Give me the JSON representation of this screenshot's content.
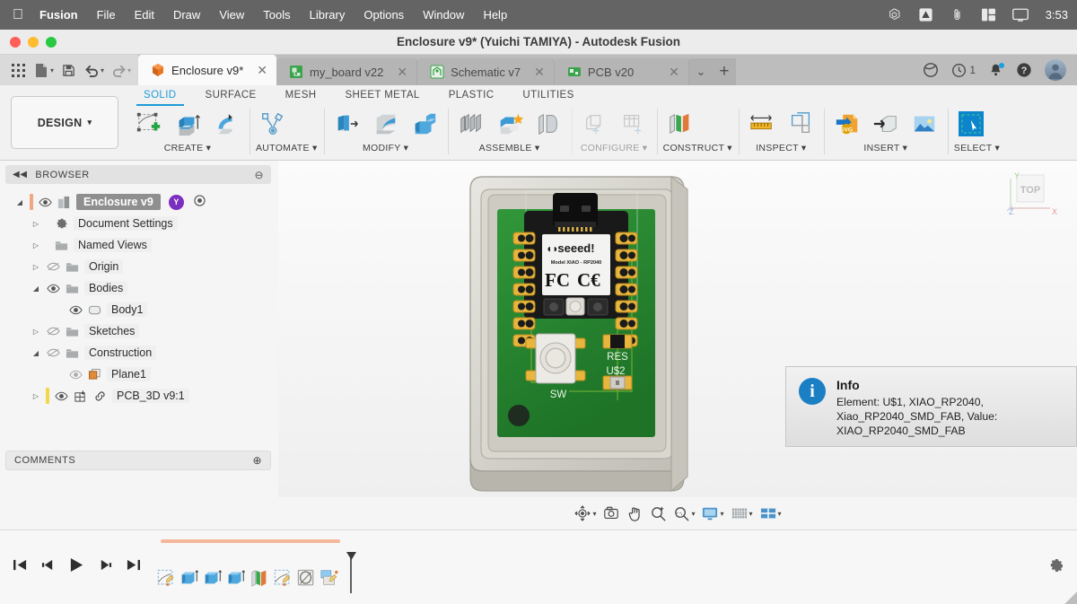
{
  "macmenu": {
    "apple": "apple-logo",
    "items": [
      {
        "label": "Fusion",
        "bold": true
      },
      {
        "label": "File",
        "bold": false
      },
      {
        "label": "Edit",
        "bold": false
      },
      {
        "label": "Draw",
        "bold": false
      },
      {
        "label": "View",
        "bold": false
      },
      {
        "label": "Tools",
        "bold": false
      },
      {
        "label": "Library",
        "bold": false
      },
      {
        "label": "Options",
        "bold": false
      },
      {
        "label": "Window",
        "bold": false
      },
      {
        "label": "Help",
        "bold": false
      }
    ],
    "status_icons": [
      "openai-icon",
      "autodesk-icon",
      "paperclip-icon",
      "layout-icon",
      "display-icon"
    ],
    "clock": "3:53"
  },
  "window": {
    "title": "Enclosure v9* (Yuichi TAMIYA) - Autodesk Fusion",
    "traffic_lights": [
      "close-button",
      "minimize-button",
      "zoom-button"
    ]
  },
  "quick_access": {
    "buttons": [
      "grid-apps-icon",
      "new-document-icon",
      "save-icon",
      "undo-icon",
      "redo-icon"
    ]
  },
  "tabs": [
    {
      "label": "Enclosure v9*",
      "icon": "fusion-design-icon",
      "active": true,
      "close": "✕"
    },
    {
      "label": "my_board v22",
      "icon": "pcb-board-icon",
      "active": false,
      "close": "✕"
    },
    {
      "label": "Schematic v7",
      "icon": "schematic-icon",
      "active": false,
      "close": "✕"
    },
    {
      "label": "PCB v20",
      "icon": "pcb-icon",
      "active": false,
      "close": "✕"
    }
  ],
  "tab_controls": {
    "dropdown": "⌄",
    "add": "+"
  },
  "tab_right": {
    "icons": [
      "job-status-icon",
      "extension-icon",
      "notification-bell-icon",
      "help-icon",
      "account-avatar"
    ],
    "extension_count": "1"
  },
  "ribbon": {
    "design_button": "DESIGN",
    "design_caret": "▾",
    "env_tabs": [
      {
        "label": "SOLID",
        "active": true
      },
      {
        "label": "SURFACE",
        "active": false
      },
      {
        "label": "MESH",
        "active": false
      },
      {
        "label": "SHEET METAL",
        "active": false
      },
      {
        "label": "PLASTIC",
        "active": false
      },
      {
        "label": "UTILITIES",
        "active": false
      }
    ],
    "panels": [
      {
        "label": "CREATE",
        "caret": "▾",
        "icons": [
          "create-sketch-icon",
          "extrude-icon",
          "revolve-icon"
        ]
      },
      {
        "label": "AUTOMATE",
        "caret": "▾",
        "icons": [
          "automate-icon"
        ]
      },
      {
        "label": "MODIFY",
        "caret": "▾",
        "icons": [
          "press-pull-icon",
          "fillet-icon",
          "shell-icon"
        ]
      },
      {
        "label": "ASSEMBLE",
        "caret": "▾",
        "icons": [
          "new-component-icon",
          "joint-icon",
          "rigid-group-icon"
        ]
      },
      {
        "label": "CONFIGURE",
        "caret": "▾",
        "icons": [
          "configure-icon",
          "config-table-icon"
        ]
      },
      {
        "label": "CONSTRUCT",
        "caret": "▾",
        "icons": [
          "construct-plane-icon"
        ]
      },
      {
        "label": "INSPECT",
        "caret": "▾",
        "icons": [
          "measure-icon",
          "section-analysis-icon"
        ]
      },
      {
        "label": "INSERT",
        "caret": "▾",
        "icons": [
          "insert-svg-icon",
          "insert-derive-icon",
          "insert-image-icon"
        ]
      },
      {
        "label": "SELECT",
        "caret": "▾",
        "icons": [
          "select-window-icon"
        ]
      }
    ]
  },
  "browser": {
    "header": "BROWSER",
    "collapse_icon": "collapse-left-icon",
    "minus_icon": "⊖",
    "tree": [
      {
        "indent": 0,
        "arrow": "◢",
        "eye": "visible",
        "icon": "component-icon",
        "label": "Enclosure v9",
        "root": true,
        "badge": "Y",
        "radio": "radio-icon",
        "marker": "#f0a882"
      },
      {
        "indent": 1,
        "arrow": "▷",
        "eye": "none",
        "icon": "gear-icon",
        "label": "Document Settings",
        "root": false
      },
      {
        "indent": 1,
        "arrow": "▷",
        "eye": "none",
        "icon": "folder-icon",
        "label": "Named Views",
        "root": false
      },
      {
        "indent": 1,
        "arrow": "▷",
        "eye": "hidden",
        "icon": "folder-icon",
        "label": "Origin",
        "root": false
      },
      {
        "indent": 1,
        "arrow": "◢",
        "eye": "visible",
        "icon": "folder-icon",
        "label": "Bodies",
        "root": false
      },
      {
        "indent": 2,
        "arrow": "",
        "eye": "visible",
        "icon": "body-icon",
        "label": "Body1",
        "root": false
      },
      {
        "indent": 1,
        "arrow": "▷",
        "eye": "hidden",
        "icon": "folder-icon",
        "label": "Sketches",
        "root": false
      },
      {
        "indent": 1,
        "arrow": "◢",
        "eye": "hidden",
        "icon": "folder-icon",
        "label": "Construction",
        "root": false
      },
      {
        "indent": 2,
        "arrow": "",
        "eye": "visible-dim",
        "icon": "plane-icon",
        "label": "Plane1",
        "root": false
      },
      {
        "indent": 1,
        "arrow": "▷",
        "eye": "visible",
        "icon": "pcb3d-icon",
        "label": "PCB_3D v9:1",
        "root": false,
        "link": "link-icon",
        "marker": "#f2d64b"
      }
    ]
  },
  "comments": {
    "label": "COMMENTS",
    "add": "⊕"
  },
  "viewcube": {
    "face": "TOP",
    "axes": [
      {
        "name": "Y",
        "color": "#5aa832"
      },
      {
        "name": "Z",
        "color": "#3b6fd4"
      },
      {
        "name": "X",
        "color": "#d44646"
      }
    ]
  },
  "model": {
    "board_labels": [
      {
        "text": "seeed!",
        "name": "seeed-logo"
      },
      {
        "text": "Model XIAO - RP2040",
        "name": "module-model-text"
      },
      {
        "text": "FC",
        "name": "fcc-mark"
      },
      {
        "text": "CE",
        "name": "ce-mark"
      },
      {
        "text": "SW",
        "name": "silkscreen-sw"
      },
      {
        "text": "RES",
        "name": "silkscreen-res"
      },
      {
        "text": "U$2",
        "name": "silkscreen-u2"
      }
    ],
    "colors": {
      "pcb": "#2a8a2f",
      "enclosure": "#cfcdc4",
      "module": "#1d1d1d",
      "pad": "#e0a72a"
    }
  },
  "info_panel": {
    "title": "Info",
    "icon": "info-icon",
    "text": "Element: U$1, XIAO_RP2040, Xiao_RP2040_SMD_FAB, Value: XIAO_RP2040_SMD_FAB"
  },
  "navbar": {
    "buttons": [
      {
        "name": "orbit-icon",
        "caret": "▾"
      },
      {
        "name": "look-at-icon",
        "caret": ""
      },
      {
        "name": "pan-icon",
        "caret": ""
      },
      {
        "name": "zoom-icon",
        "caret": ""
      },
      {
        "name": "zoom-window-icon",
        "caret": "▾"
      },
      {
        "name": "display-settings-icon",
        "caret": "▾"
      },
      {
        "name": "grid-snaps-icon",
        "caret": "▾"
      },
      {
        "name": "viewports-icon",
        "caret": "▾"
      }
    ]
  },
  "timeline": {
    "playback": [
      "skip-start-icon",
      "step-back-icon",
      "play-icon",
      "step-forward-icon",
      "skip-end-icon"
    ],
    "features": [
      "sketch-feature-icon",
      "extrude-feature-icon",
      "extrude-feature-icon",
      "extrude-feature-icon",
      "shell-feature-icon",
      "sketch-feature-icon",
      "hole-feature-icon",
      "component-feature-icon"
    ],
    "marker": "timeline-marker",
    "settings": "gear-icon"
  }
}
